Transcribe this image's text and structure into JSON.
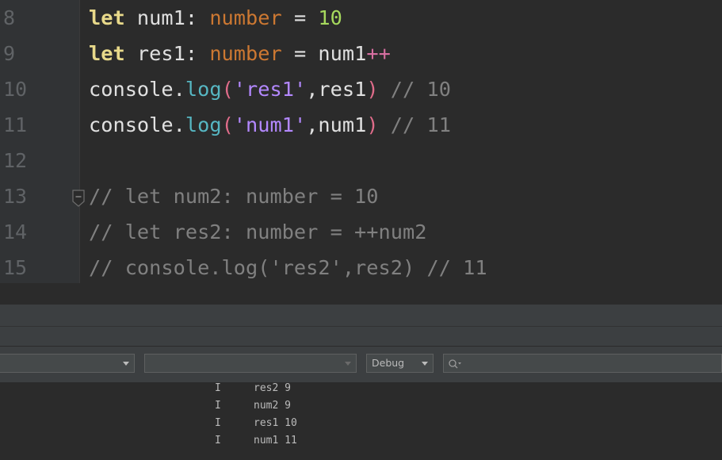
{
  "editor": {
    "lines": [
      {
        "number": "8"
      },
      {
        "number": "9"
      },
      {
        "number": "10"
      },
      {
        "number": "11"
      },
      {
        "number": "12"
      },
      {
        "number": "13"
      },
      {
        "number": "14"
      },
      {
        "number": "15"
      }
    ],
    "tokens": {
      "let": "let",
      "number_type": "number",
      "l8_var": " num1: ",
      "eq": " = ",
      "l8_val": "10",
      "l9_var": " res1: ",
      "l9_rhs": "num1",
      "plusplus": "++",
      "console": "console",
      "dot": ".",
      "log": "log",
      "lparen": "(",
      "rparen": ")",
      "l10_str": "'res1'",
      "l10_arg": ",res1",
      "l10_comment": " // 10",
      "l11_str": "'num1'",
      "l11_arg": ",num1",
      "l11_comment": " // 11",
      "l13_comment": "// let num2: number = 10",
      "l14_comment": "// let res2: number = ++num2",
      "l15_comment": "// console.log('res2',res2) // 11"
    }
  },
  "toolbar": {
    "device_combo": "",
    "process_combo": "",
    "log_level": "Debug",
    "search_placeholder": ""
  },
  "logs": [
    {
      "level": "I",
      "message": "res2 9"
    },
    {
      "level": "I",
      "message": "num2 9"
    },
    {
      "level": "I",
      "message": "res1 10"
    },
    {
      "level": "I",
      "message": "num1 11"
    }
  ],
  "colors": {
    "background": "#2b2b2b",
    "keyword": "#e8d98a",
    "type": "#cc7832",
    "number": "#a6d95d",
    "function": "#56b6c2",
    "string": "#b388ff",
    "comment": "#808080"
  }
}
